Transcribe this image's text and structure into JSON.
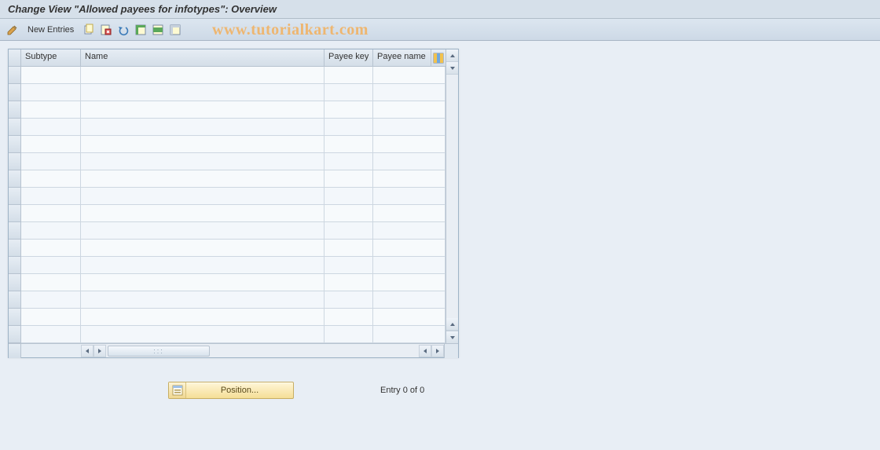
{
  "title": "Change View \"Allowed payees for infotypes\": Overview",
  "toolbar": {
    "new_entries_label": "New Entries"
  },
  "watermark": "www.tutorialkart.com",
  "table": {
    "columns": {
      "subtype": "Subtype",
      "name": "Name",
      "payee_key": "Payee key",
      "payee_name": "Payee name"
    },
    "rows": [
      {
        "subtype": "",
        "name": "",
        "payee_key": "",
        "payee_name": ""
      },
      {
        "subtype": "",
        "name": "",
        "payee_key": "",
        "payee_name": ""
      },
      {
        "subtype": "",
        "name": "",
        "payee_key": "",
        "payee_name": ""
      },
      {
        "subtype": "",
        "name": "",
        "payee_key": "",
        "payee_name": ""
      },
      {
        "subtype": "",
        "name": "",
        "payee_key": "",
        "payee_name": ""
      },
      {
        "subtype": "",
        "name": "",
        "payee_key": "",
        "payee_name": ""
      },
      {
        "subtype": "",
        "name": "",
        "payee_key": "",
        "payee_name": ""
      },
      {
        "subtype": "",
        "name": "",
        "payee_key": "",
        "payee_name": ""
      },
      {
        "subtype": "",
        "name": "",
        "payee_key": "",
        "payee_name": ""
      },
      {
        "subtype": "",
        "name": "",
        "payee_key": "",
        "payee_name": ""
      },
      {
        "subtype": "",
        "name": "",
        "payee_key": "",
        "payee_name": ""
      },
      {
        "subtype": "",
        "name": "",
        "payee_key": "",
        "payee_name": ""
      },
      {
        "subtype": "",
        "name": "",
        "payee_key": "",
        "payee_name": ""
      },
      {
        "subtype": "",
        "name": "",
        "payee_key": "",
        "payee_name": ""
      },
      {
        "subtype": "",
        "name": "",
        "payee_key": "",
        "payee_name": ""
      },
      {
        "subtype": "",
        "name": "",
        "payee_key": "",
        "payee_name": ""
      }
    ]
  },
  "position_button": "Position...",
  "entry_status": "Entry 0 of 0"
}
